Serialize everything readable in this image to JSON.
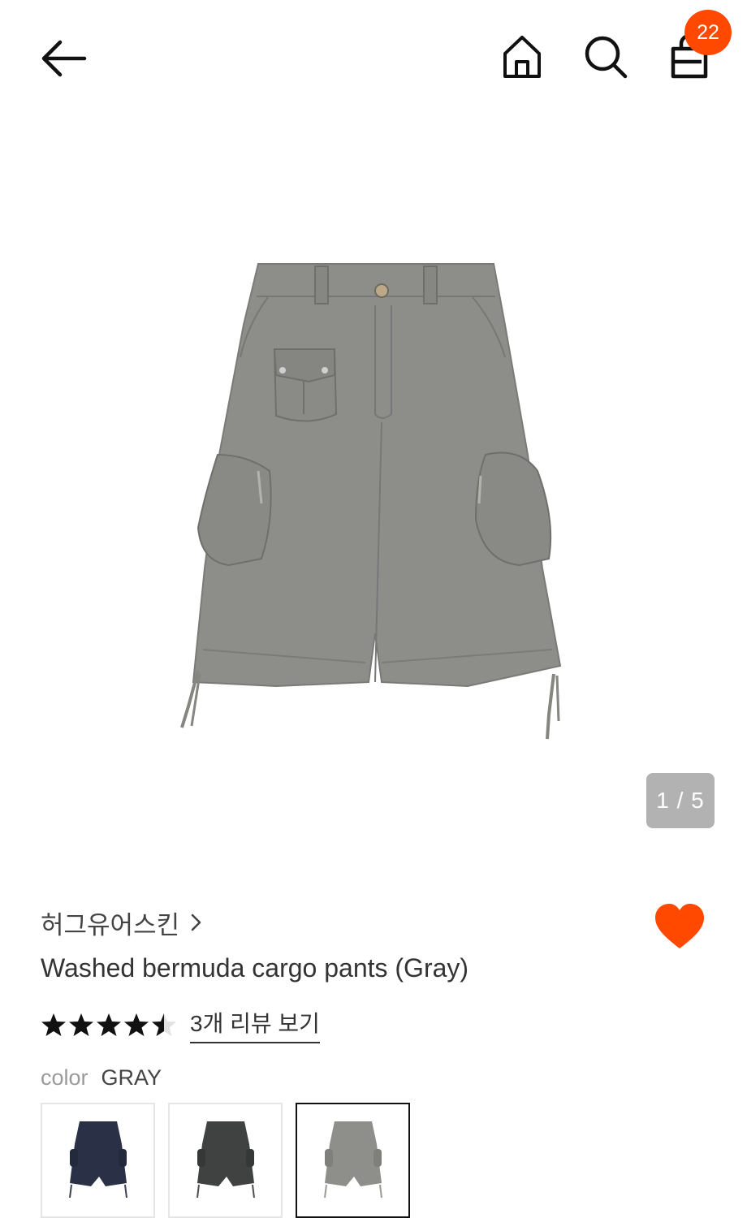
{
  "header": {
    "back_icon": "arrow-left-icon",
    "home_icon": "home-icon",
    "search_icon": "search-icon",
    "cart_icon": "shopping-bag-icon",
    "cart_count": "22",
    "badge_color": "#ff4800"
  },
  "gallery": {
    "counter": "1 / 5",
    "current": 1,
    "total": 5
  },
  "product": {
    "brand": "허그유어스킨",
    "title": "Washed bermuda cargo pants (Gray)",
    "rating": 4.5,
    "rating_max": 5,
    "review_link": "3개 리뷰 보기",
    "wishlisted": true,
    "heart_color": "#ff4800"
  },
  "color": {
    "label": "color",
    "selected": "GRAY",
    "swatches": [
      {
        "name": "navy",
        "fill": "#2a3146"
      },
      {
        "name": "charcoal",
        "fill": "#3f4240"
      },
      {
        "name": "gray",
        "fill": "#8e8f8b",
        "selected": true
      }
    ]
  }
}
